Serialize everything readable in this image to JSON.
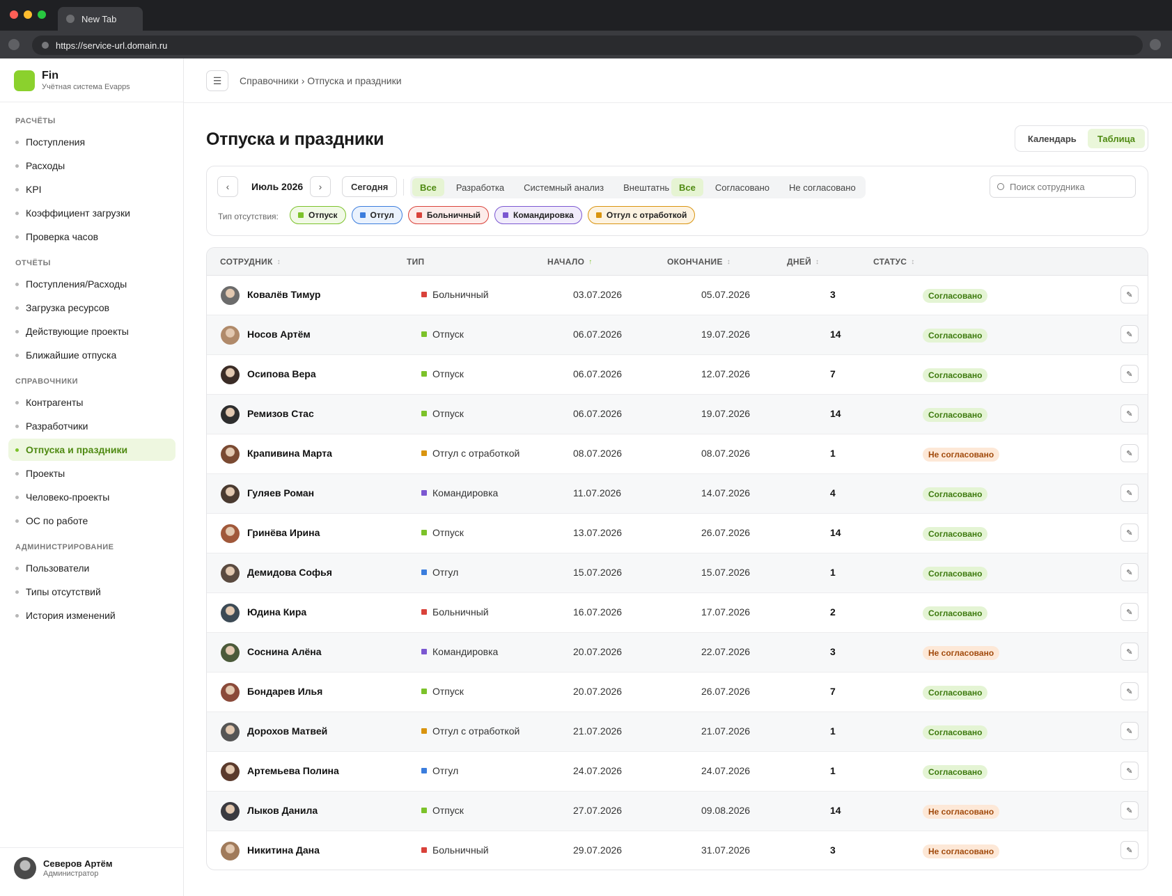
{
  "browser": {
    "tab_title": "New Tab",
    "url": "https://service-url.domain.ru"
  },
  "brand": {
    "title": "Fin",
    "subtitle": "Учётная система Evapps",
    "accent": "#8bd12d"
  },
  "sidebar": {
    "sections": [
      {
        "title": "РАСЧЁТЫ",
        "items": [
          "Поступления",
          "Расходы",
          "KPI",
          "Коэффициент загрузки",
          "Проверка часов"
        ]
      },
      {
        "title": "ОТЧЁТЫ",
        "items": [
          "Поступления/Расходы",
          "Загрузка ресурсов",
          "Действующие проекты",
          "Ближайшие отпуска"
        ]
      },
      {
        "title": "СПРАВОЧНИКИ",
        "items": [
          "Контрагенты",
          "Разработчики",
          "Отпуска и праздники",
          "Проекты",
          "Человеко-проекты",
          "ОС по работе"
        ]
      },
      {
        "title": "АДМИНИСТРИРОВАНИЕ",
        "items": [
          "Пользователи",
          "Типы отсутствий",
          "История изменений"
        ]
      }
    ],
    "active_item": "Отпуска и праздники",
    "user": {
      "name": "Северов Артём",
      "role": "Администратор"
    }
  },
  "header": {
    "breadcrumb": "Справочники › Отпуска и праздники",
    "title": "Отпуска и праздники",
    "view_calendar": "Календарь",
    "view_table": "Таблица",
    "active_view": "Таблица"
  },
  "filters": {
    "month": "Июль 2026",
    "prev": "‹",
    "next": "›",
    "today": "Сегодня",
    "departments": [
      "Все",
      "Разработка",
      "Системный анализ",
      "Внештатные"
    ],
    "department_active": "Все",
    "statuses": [
      "Все",
      "Согласовано",
      "Не согласовано"
    ],
    "status_active": "Все",
    "search_placeholder": "Поиск сотрудника",
    "type_label": "Тип отсутствия:",
    "types": [
      {
        "label": "Отпуск",
        "color": "#7cc22a",
        "bg": "#f1f9e6"
      },
      {
        "label": "Отгул",
        "color": "#3b7ddd",
        "bg": "#eaf2fd"
      },
      {
        "label": "Больничный",
        "color": "#d9423a",
        "bg": "#fdecea"
      },
      {
        "label": "Командировка",
        "color": "#7b57d1",
        "bg": "#f1ecfb"
      },
      {
        "label": "Отгул с отработкой",
        "color": "#d9940f",
        "bg": "#fdf3e1"
      }
    ]
  },
  "table": {
    "columns": [
      "СОТРУДНИК",
      "ТИП",
      "НАЧАЛО",
      "ОКОНЧАНИЕ",
      "ДНЕЙ",
      "СТАТУС"
    ],
    "sorted_column": "НАЧАЛО",
    "edit_icon": "✎",
    "rows": [
      {
        "name": "Ковалёв Тимур",
        "type": "Больничный",
        "type_color": "#d9423a",
        "start": "03.07.2026",
        "end": "05.07.2026",
        "days": "3",
        "status": "Согласовано",
        "status_kind": "ok",
        "avatar_color": "#6b6b6b"
      },
      {
        "name": "Носов Артём",
        "type": "Отпуск",
        "type_color": "#7cc22a",
        "start": "06.07.2026",
        "end": "19.07.2026",
        "days": "14",
        "status": "Согласовано",
        "status_kind": "ok",
        "avatar_color": "#b08a6a"
      },
      {
        "name": "Осипова Вера",
        "type": "Отпуск",
        "type_color": "#7cc22a",
        "start": "06.07.2026",
        "end": "12.07.2026",
        "days": "7",
        "status": "Согласовано",
        "status_kind": "ok",
        "avatar_color": "#3a2c26"
      },
      {
        "name": "Ремизов Стас",
        "type": "Отпуск",
        "type_color": "#7cc22a",
        "start": "06.07.2026",
        "end": "19.07.2026",
        "days": "14",
        "status": "Согласовано",
        "status_kind": "ok",
        "avatar_color": "#2e2e2e"
      },
      {
        "name": "Крапивина Марта",
        "type": "Отгул с отработкой",
        "type_color": "#d9940f",
        "start": "08.07.2026",
        "end": "08.07.2026",
        "days": "1",
        "status": "Не согласовано",
        "status_kind": "no",
        "avatar_color": "#7a4a32"
      },
      {
        "name": "Гуляев Роман",
        "type": "Командировка",
        "type_color": "#7b57d1",
        "start": "11.07.2026",
        "end": "14.07.2026",
        "days": "4",
        "status": "Согласовано",
        "status_kind": "ok",
        "avatar_color": "#4a3a30"
      },
      {
        "name": "Гринёва Ирина",
        "type": "Отпуск",
        "type_color": "#7cc22a",
        "start": "13.07.2026",
        "end": "26.07.2026",
        "days": "14",
        "status": "Согласовано",
        "status_kind": "ok",
        "avatar_color": "#a0583a"
      },
      {
        "name": "Демидова Софья",
        "type": "Отгул",
        "type_color": "#3b7ddd",
        "start": "15.07.2026",
        "end": "15.07.2026",
        "days": "1",
        "status": "Согласовано",
        "status_kind": "ok",
        "avatar_color": "#5a4a40"
      },
      {
        "name": "Юдина Кира",
        "type": "Больничный",
        "type_color": "#d9423a",
        "start": "16.07.2026",
        "end": "17.07.2026",
        "days": "2",
        "status": "Согласовано",
        "status_kind": "ok",
        "avatar_color": "#3c4a55"
      },
      {
        "name": "Соснина Алёна",
        "type": "Командировка",
        "type_color": "#7b57d1",
        "start": "20.07.2026",
        "end": "22.07.2026",
        "days": "3",
        "status": "Не согласовано",
        "status_kind": "no",
        "avatar_color": "#4b5a3a"
      },
      {
        "name": "Бондарев Илья",
        "type": "Отпуск",
        "type_color": "#7cc22a",
        "start": "20.07.2026",
        "end": "26.07.2026",
        "days": "7",
        "status": "Согласовано",
        "status_kind": "ok",
        "avatar_color": "#8a4a3a"
      },
      {
        "name": "Дорохов Матвей",
        "type": "Отгул с отработкой",
        "type_color": "#d9940f",
        "start": "21.07.2026",
        "end": "21.07.2026",
        "days": "1",
        "status": "Согласовано",
        "status_kind": "ok",
        "avatar_color": "#555555"
      },
      {
        "name": "Артемьева Полина",
        "type": "Отгул",
        "type_color": "#3b7ddd",
        "start": "24.07.2026",
        "end": "24.07.2026",
        "days": "1",
        "status": "Согласовано",
        "status_kind": "ok",
        "avatar_color": "#5a3a2c"
      },
      {
        "name": "Лыков Данила",
        "type": "Отпуск",
        "type_color": "#7cc22a",
        "start": "27.07.2026",
        "end": "09.08.2026",
        "days": "14",
        "status": "Не согласовано",
        "status_kind": "no",
        "avatar_color": "#3a3a40"
      },
      {
        "name": "Никитина Дана",
        "type": "Больничный",
        "type_color": "#d9423a",
        "start": "29.07.2026",
        "end": "31.07.2026",
        "days": "3",
        "status": "Не согласовано",
        "status_kind": "no",
        "avatar_color": "#a07a5a"
      }
    ]
  }
}
